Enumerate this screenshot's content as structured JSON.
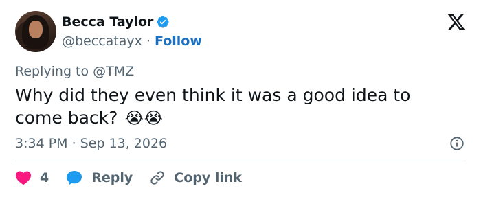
{
  "author": {
    "name": "Becca Taylor",
    "handle": "@beccatayx",
    "separator": "·",
    "follow_label": "Follow"
  },
  "reply_context": {
    "prefix": "Replying to",
    "mention": "@TMZ"
  },
  "tweet": {
    "text": "Why did they even think it was a good idea to come back?",
    "emojis": "😭😭"
  },
  "meta": {
    "timestamp": "3:34 PM · Sep 13, 2026"
  },
  "actions": {
    "like_count": "4",
    "reply_label": "Reply",
    "copy_link_label": "Copy link"
  },
  "colors": {
    "like": "#f91880",
    "reply": "#1d9bf0",
    "follow": "#1d6fbf",
    "verified": "#1d9bf0"
  }
}
